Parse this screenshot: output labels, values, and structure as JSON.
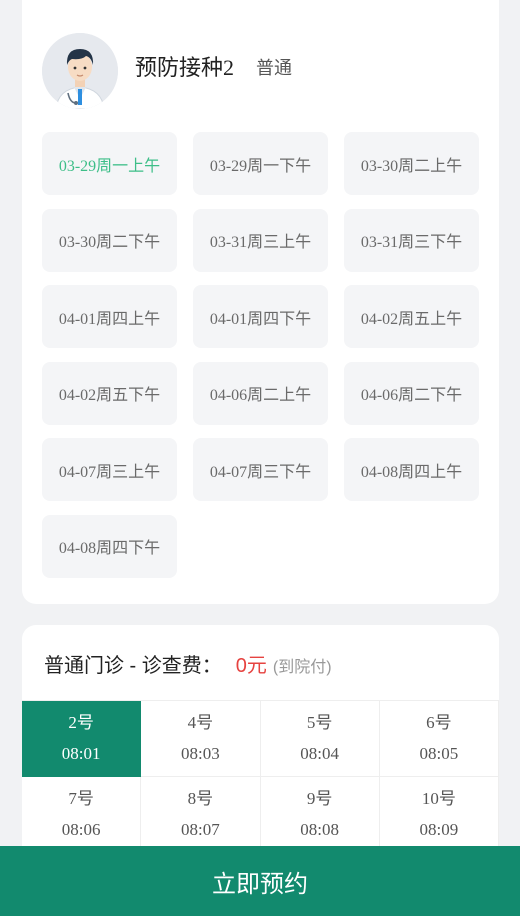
{
  "doctor": {
    "name": "预防接种2",
    "level": "普通"
  },
  "schedule_slots": [
    {
      "label": "03-29周一上午",
      "active": true
    },
    {
      "label": "03-29周一下午",
      "active": false
    },
    {
      "label": "03-30周二上午",
      "active": false
    },
    {
      "label": "03-30周二下午",
      "active": false
    },
    {
      "label": "03-31周三上午",
      "active": false
    },
    {
      "label": "03-31周三下午",
      "active": false
    },
    {
      "label": "04-01周四上午",
      "active": false
    },
    {
      "label": "04-01周四下午",
      "active": false
    },
    {
      "label": "04-02周五上午",
      "active": false
    },
    {
      "label": "04-02周五下午",
      "active": false
    },
    {
      "label": "04-06周二上午",
      "active": false
    },
    {
      "label": "04-06周二下午",
      "active": false
    },
    {
      "label": "04-07周三上午",
      "active": false
    },
    {
      "label": "04-07周三下午",
      "active": false
    },
    {
      "label": "04-08周四上午",
      "active": false
    },
    {
      "label": "04-08周四下午",
      "active": false
    }
  ],
  "fee": {
    "title": "普通门诊 - 诊查费：",
    "amount": "0元",
    "note": "(到院付)"
  },
  "numbers": [
    {
      "num": "2号",
      "time": "08:01",
      "selected": true
    },
    {
      "num": "4号",
      "time": "08:03",
      "selected": false
    },
    {
      "num": "5号",
      "time": "08:04",
      "selected": false
    },
    {
      "num": "6号",
      "time": "08:05",
      "selected": false
    },
    {
      "num": "7号",
      "time": "08:06",
      "selected": false
    },
    {
      "num": "8号",
      "time": "08:07",
      "selected": false
    },
    {
      "num": "9号",
      "time": "08:08",
      "selected": false
    },
    {
      "num": "10号",
      "time": "08:09",
      "selected": false
    }
  ],
  "book_button": "立即预约",
  "colors": {
    "accent": "#128a6e",
    "active_slot_text": "#3dbe88",
    "fee_amount": "#e64340"
  }
}
